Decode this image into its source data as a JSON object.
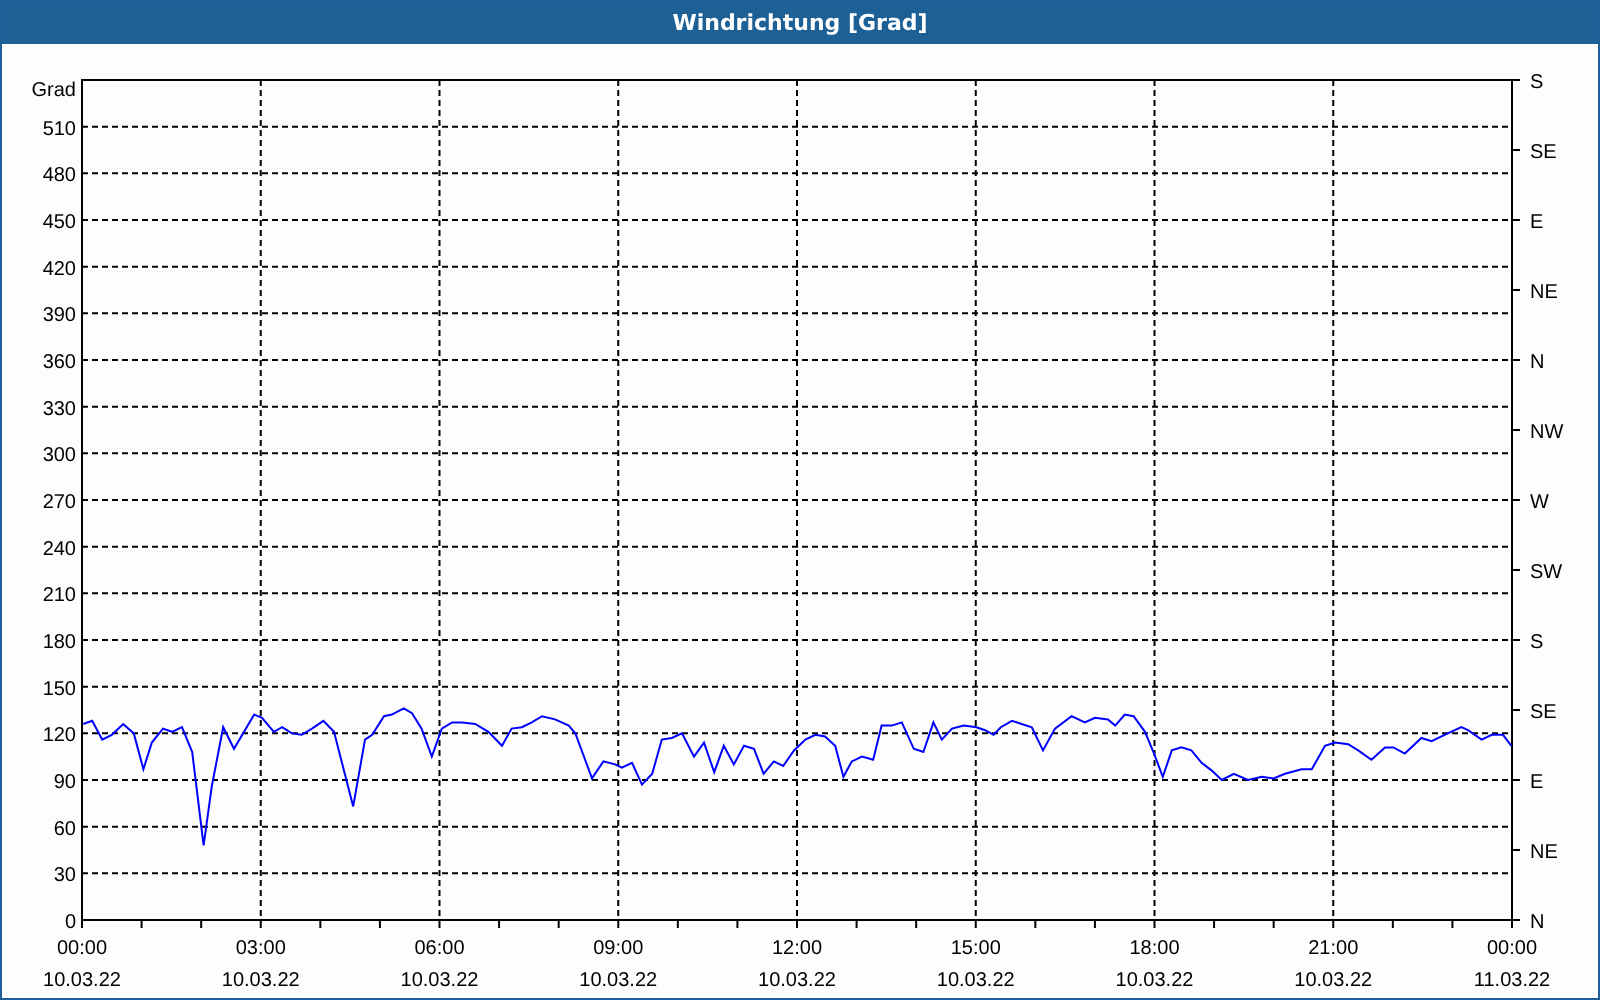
{
  "window": {
    "title": "Windrichtung [Grad]"
  },
  "chart": {
    "date_labels": [
      "10.03.22",
      "10.03.22",
      "10.03.22",
      "10.03.22",
      "10.03.22",
      "10.03.22",
      "10.03.22",
      "10.03.22",
      "11.03.22"
    ],
    "compass_labels": [
      "S",
      "SE",
      "E",
      "NE",
      "N",
      "NW",
      "W",
      "SW",
      "S",
      "SE",
      "E",
      "NE",
      "N"
    ],
    "chart_data": {
      "type": "line",
      "ylabel": "Grad",
      "grid": true,
      "xlim": [
        0,
        24
      ],
      "ylim": [
        0,
        540
      ],
      "xticks": [
        {
          "value": 0,
          "label": "00:00"
        },
        {
          "value": 3,
          "label": "03:00"
        },
        {
          "value": 6,
          "label": "06:00"
        },
        {
          "value": 9,
          "label": "09:00"
        },
        {
          "value": 12,
          "label": "12:00"
        },
        {
          "value": 15,
          "label": "15:00"
        },
        {
          "value": 18,
          "label": "18:00"
        },
        {
          "value": 21,
          "label": "21:00"
        },
        {
          "value": 24,
          "label": "00:00"
        }
      ],
      "yticks": [
        0,
        30,
        60,
        90,
        120,
        150,
        180,
        210,
        240,
        270,
        300,
        330,
        360,
        390,
        420,
        450,
        480,
        510
      ],
      "x": [
        0.02,
        0.17,
        0.34,
        0.5,
        0.69,
        0.87,
        1.03,
        1.17,
        1.36,
        1.51,
        1.68,
        1.85,
        2.04,
        2.18,
        2.37,
        2.55,
        2.89,
        3.02,
        3.22,
        3.36,
        3.52,
        3.69,
        3.86,
        4.05,
        4.23,
        4.55,
        4.75,
        4.87,
        5.07,
        5.2,
        5.4,
        5.54,
        5.7,
        5.87,
        6.04,
        6.21,
        6.38,
        6.6,
        6.82,
        7.05,
        7.21,
        7.38,
        7.55,
        7.72,
        7.94,
        8.17,
        8.28,
        8.56,
        8.75,
        8.95,
        9.06,
        9.23,
        9.4,
        9.57,
        9.73,
        9.9,
        10.07,
        10.27,
        10.44,
        10.61,
        10.77,
        10.94,
        11.11,
        11.28,
        11.44,
        11.61,
        11.77,
        11.95,
        12.14,
        12.31,
        12.47,
        12.64,
        12.78,
        12.92,
        13.09,
        13.28,
        13.42,
        13.59,
        13.76,
        13.96,
        14.12,
        14.29,
        14.43,
        14.6,
        14.8,
        15.01,
        15.16,
        15.3,
        15.42,
        15.61,
        15.77,
        15.94,
        16.13,
        16.33,
        16.61,
        16.83,
        17.0,
        17.22,
        17.34,
        17.5,
        17.65,
        17.84,
        17.98,
        18.14,
        18.29,
        18.45,
        18.62,
        18.79,
        18.96,
        19.13,
        19.33,
        19.57,
        19.8,
        20.0,
        20.19,
        20.47,
        20.64,
        20.86,
        21.03,
        21.25,
        21.42,
        21.64,
        21.87,
        22.01,
        22.2,
        22.48,
        22.65,
        22.87,
        23.15,
        23.26,
        23.49,
        23.66,
        23.85,
        23.99
      ],
      "series": [
        {
          "color": "#0000ff",
          "values": [
            126,
            128,
            116,
            119,
            126,
            120,
            97,
            114,
            123,
            121,
            124,
            108,
            48,
            86,
            124,
            110,
            132,
            130,
            121,
            124,
            120,
            119,
            123,
            128,
            121,
            73,
            116,
            119,
            131,
            132,
            136,
            133,
            123,
            105,
            123,
            127,
            127,
            126,
            121,
            112,
            123,
            124,
            127,
            131,
            129,
            125,
            120,
            91,
            102,
            100,
            98,
            101,
            87,
            94,
            116,
            117,
            120,
            105,
            114,
            95,
            112,
            100,
            112,
            110,
            94,
            102,
            99,
            109,
            116,
            119,
            118,
            112,
            92,
            102,
            105,
            103,
            125,
            125,
            127,
            110,
            108,
            127,
            116,
            123,
            125,
            124,
            122,
            119,
            124,
            128,
            126,
            124,
            109,
            123,
            131,
            127,
            130,
            129,
            125,
            132,
            131,
            121,
            108,
            92,
            109,
            111,
            109,
            101,
            96,
            90,
            94,
            90,
            92,
            91,
            94,
            97,
            97,
            112,
            114,
            113,
            109,
            103,
            111,
            111,
            107,
            117,
            115,
            119,
            124,
            122,
            116,
            119,
            119,
            112
          ]
        }
      ]
    }
  }
}
